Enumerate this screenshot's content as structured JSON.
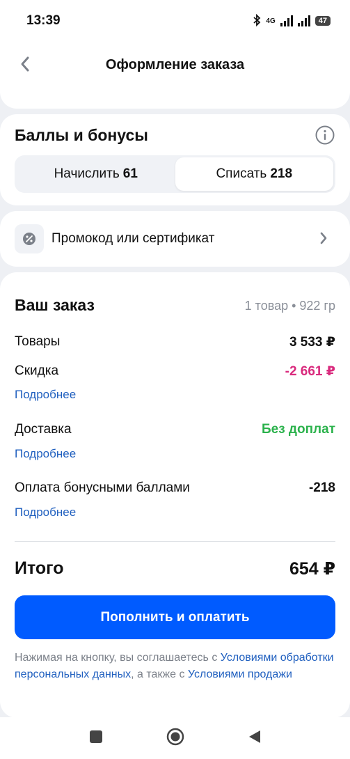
{
  "status_bar": {
    "time": "13:39",
    "network": "4G",
    "battery": "47"
  },
  "header": {
    "title": "Оформление заказа"
  },
  "bonuses": {
    "title": "Баллы и бонусы",
    "accrue_label": "Начислить",
    "accrue_value": "61",
    "spend_label": "Списать",
    "spend_value": "218",
    "selected": "spend"
  },
  "promo": {
    "label": "Промокод или сертификат"
  },
  "order": {
    "title": "Ваш заказ",
    "meta": "1 товар • 922 гр",
    "goods_label": "Товары",
    "goods_value": "3 533 ₽",
    "discount_label": "Скидка",
    "discount_value": "-2 661 ₽",
    "discount_more": "Подробнее",
    "delivery_label": "Доставка",
    "delivery_value": "Без доплат",
    "delivery_more": "Подробнее",
    "bonus_pay_label": "Оплата бонусными баллами",
    "bonus_pay_value": "-218",
    "bonus_pay_more": "Подробнее",
    "total_label": "Итого",
    "total_value": "654 ₽",
    "pay_button": "Пополнить и оплатить"
  },
  "legal": {
    "text_1": "Нажимая на кнопку, вы соглашаетесь с ",
    "link_1": "Условиями обработки персональных данных",
    "text_2": ", а также с ",
    "link_2": "Условиями продажи"
  },
  "colors": {
    "accent": "#005bff",
    "discount": "#d92a7d",
    "success": "#2bb24c",
    "link": "#1f5fbf"
  }
}
